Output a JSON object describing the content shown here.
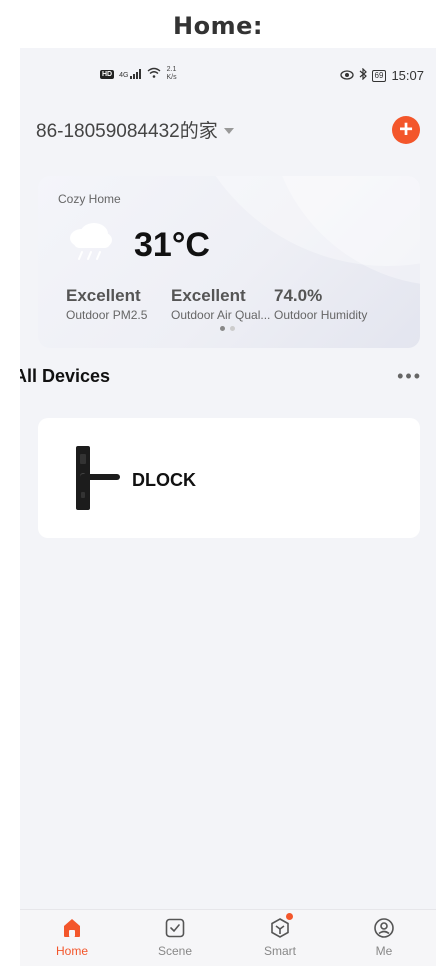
{
  "caption": "Home:",
  "status_bar": {
    "hd": "HD",
    "signal": "4G",
    "net_speed": "2.1",
    "net_unit": "K/s",
    "battery": "69",
    "time": "15:07"
  },
  "header": {
    "home_name": "86-18059084432的家",
    "add_label": "+"
  },
  "weather": {
    "location": "Cozy Home",
    "temperature": "31°C",
    "stats": [
      {
        "value": "Excellent",
        "label": "Outdoor PM2.5"
      },
      {
        "value": "Excellent",
        "label": "Outdoor Air Qual..."
      },
      {
        "value": "74.0%",
        "label": "Outdoor Humidity"
      }
    ]
  },
  "devices": {
    "title": "All Devices",
    "more": "•••",
    "items": [
      {
        "name": "DLOCK"
      }
    ]
  },
  "tabbar": {
    "tabs": [
      {
        "label": "Home",
        "icon": "home-icon"
      },
      {
        "label": "Scene",
        "icon": "scene-icon"
      },
      {
        "label": "Smart",
        "icon": "smart-icon"
      },
      {
        "label": "Me",
        "icon": "profile-icon"
      }
    ]
  },
  "colors": {
    "accent": "#f3562b",
    "background": "#f3f4f8"
  }
}
